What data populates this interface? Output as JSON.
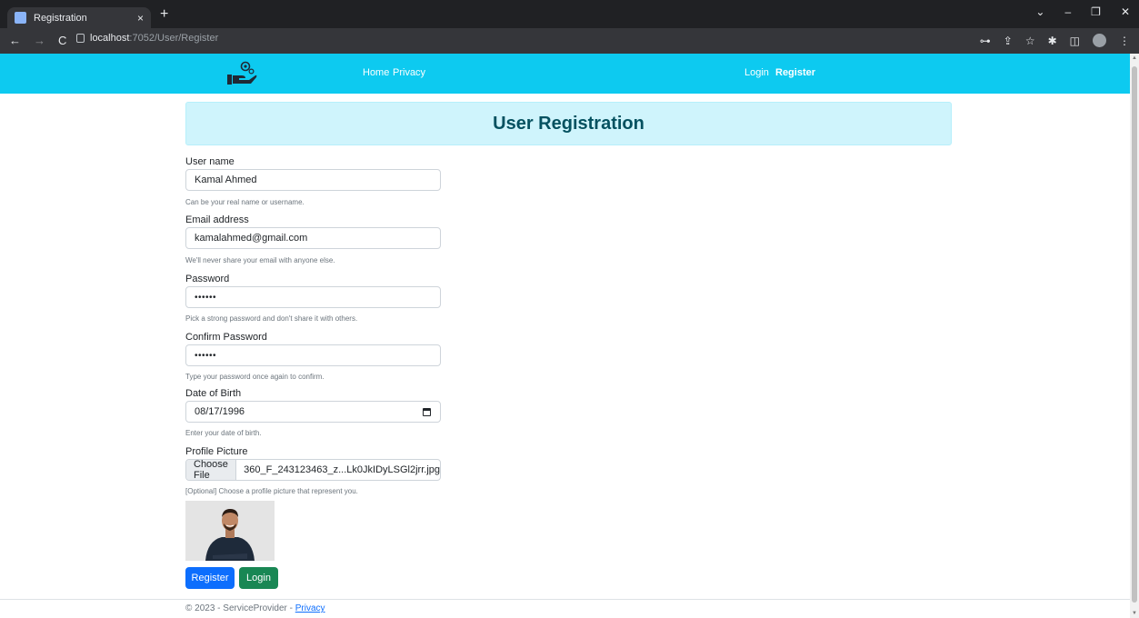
{
  "browser": {
    "tab_title": "Registration",
    "tab_close": "×",
    "new_tab": "+",
    "url_host": "localhost",
    "url_path": ":7052/User/Register",
    "window_controls": [
      "⌄",
      "–",
      "❐",
      "✕"
    ],
    "nav_glyphs": [
      "←",
      "→",
      "C"
    ],
    "extension_glyphs": [
      "⊶",
      "⇪",
      "☆",
      "✱",
      "◫",
      "⋮"
    ]
  },
  "navbar": {
    "brand_icon": "hand-gear-logo-icon",
    "home": "Home",
    "privacy": "Privacy",
    "login": "Login",
    "register": "Register"
  },
  "page": {
    "title": "User Registration"
  },
  "form": {
    "username": {
      "label": "User name",
      "value": "Kamal Ahmed",
      "help": "Can be your real name or username."
    },
    "email": {
      "label": "Email address",
      "value": "kamalahmed@gmail.com",
      "help": "We'll never share your email with anyone else."
    },
    "password": {
      "label": "Password",
      "value": "••••••",
      "help": "Pick a strong password and don't share it with others."
    },
    "confirm_password": {
      "label": "Confirm Password",
      "value": "••••••",
      "help": "Type your password once again to confirm."
    },
    "dob": {
      "label": "Date of Birth",
      "value": "08/17/1996",
      "help": "Enter your date of birth."
    },
    "picture": {
      "label": "Profile Picture",
      "button": "Choose File",
      "filename": "360_F_243123463_z...Lk0JkIDyLSGl2jrr.jpg",
      "help": "[Optional] Choose a profile picture that represent you."
    }
  },
  "buttons": {
    "register": "Register",
    "login": "Login"
  },
  "footer": {
    "text": "© 2023 - ServiceProvider - ",
    "link": "Privacy"
  },
  "colors": {
    "navbar": "#0dcaf0",
    "heading_bg": "#cff4fc",
    "heading_text": "#055160",
    "primary": "#0d6efd",
    "success": "#198754"
  }
}
